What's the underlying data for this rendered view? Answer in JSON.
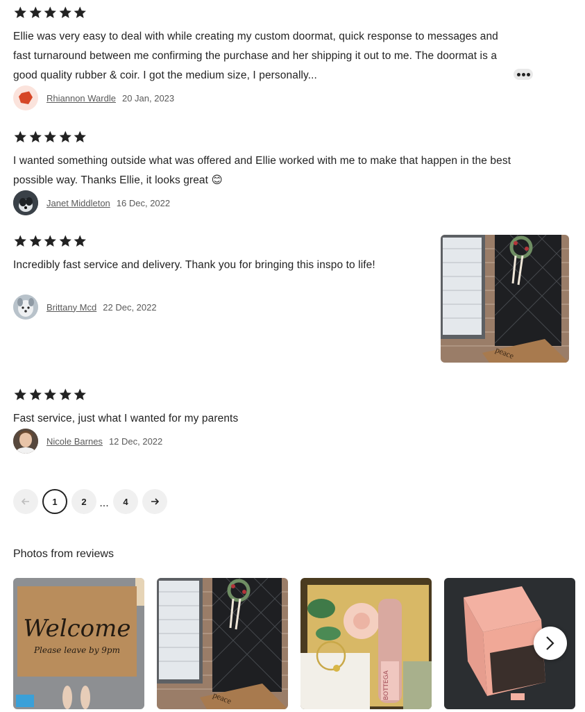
{
  "reviews": [
    {
      "rating": 5,
      "text": "Ellie was very easy to deal with while creating my custom doormat, quick response to messages and fast turnaround between me confirming the purchase and her shipping it out to me. The doormat is a good quality rubber & coir. I got the medium size, I personally...",
      "reviewer": "Rhiannon Wardle",
      "date": "20 Jan, 2023",
      "more_icon": "ellipsis-icon"
    },
    {
      "rating": 5,
      "text": "I wanted something outside what was offered and Ellie worked with me to make that happen in the best possible way. Thanks Ellie, it looks great 😊",
      "reviewer": "Janet Middleton",
      "date": "16 Dec, 2022"
    },
    {
      "rating": 5,
      "text": "Incredibly fast service and delivery. Thank you for bringing this inspo to life!",
      "reviewer": "Brittany Mcd",
      "date": "22 Dec, 2022",
      "photo_doormat_text": "peace"
    },
    {
      "rating": 5,
      "text": "Fast service, just what I wanted for my parents",
      "reviewer": "Nicole Barnes",
      "date": "12 Dec, 2022"
    }
  ],
  "pagination": {
    "prev_icon": "arrow-left-icon",
    "pages": [
      "1",
      "2",
      "4"
    ],
    "ellipsis": "...",
    "current": "1",
    "next_icon": "arrow-right-icon"
  },
  "photos": {
    "heading": "Photos from reviews",
    "doormat_welcome": "Welcome",
    "doormat_sub": "Please leave by 9pm",
    "doormat_peace": "peace",
    "bottle_label": "BOTTEGA",
    "next_icon": "chevron-right-icon"
  },
  "colors": {
    "star": "#222222",
    "text": "#222222",
    "muted": "#595959",
    "brand_avatar": "#d64727"
  }
}
